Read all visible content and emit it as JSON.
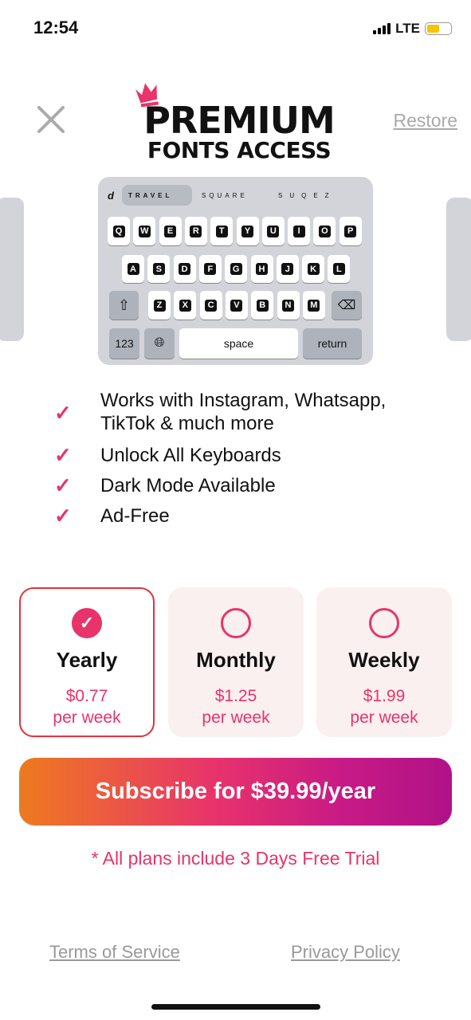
{
  "status": {
    "time": "12:54",
    "network": "LTE",
    "battery_color": "#f2c500"
  },
  "header": {
    "restore": "Restore",
    "logo_line1": "PREMIUM",
    "logo_line2": "FONTS ACCESS"
  },
  "keyboard": {
    "suggestions": {
      "first": "d",
      "travel": "TRAVEL",
      "square": "SQUARE",
      "suqez": "SUQEZ"
    },
    "row1": [
      "Q",
      "W",
      "E",
      "R",
      "T",
      "Y",
      "U",
      "I",
      "O",
      "P"
    ],
    "row2": [
      "A",
      "S",
      "D",
      "F",
      "G",
      "H",
      "J",
      "K",
      "L"
    ],
    "row3": [
      "Z",
      "X",
      "C",
      "V",
      "B",
      "N",
      "M"
    ],
    "numbers": "123",
    "space": "space",
    "return": "return"
  },
  "features": [
    "Works with Instagram, Whatsapp, TikTok & much more",
    "Unlock All Keyboards",
    "Dark Mode Available",
    "Ad-Free"
  ],
  "plans": [
    {
      "name": "Yearly",
      "price": "$0.77",
      "unit": "per week",
      "selected": true
    },
    {
      "name": "Monthly",
      "price": "$1.25",
      "unit": "per week",
      "selected": false
    },
    {
      "name": "Weekly",
      "price": "$1.99",
      "unit": "per week",
      "selected": false
    }
  ],
  "subscribe": "Subscribe for $39.99/year",
  "trial_note": "* All plans include 3 Days Free Trial",
  "footer": {
    "terms": "Terms of Service",
    "privacy": "Privacy Policy"
  },
  "accent": "#e8336b"
}
